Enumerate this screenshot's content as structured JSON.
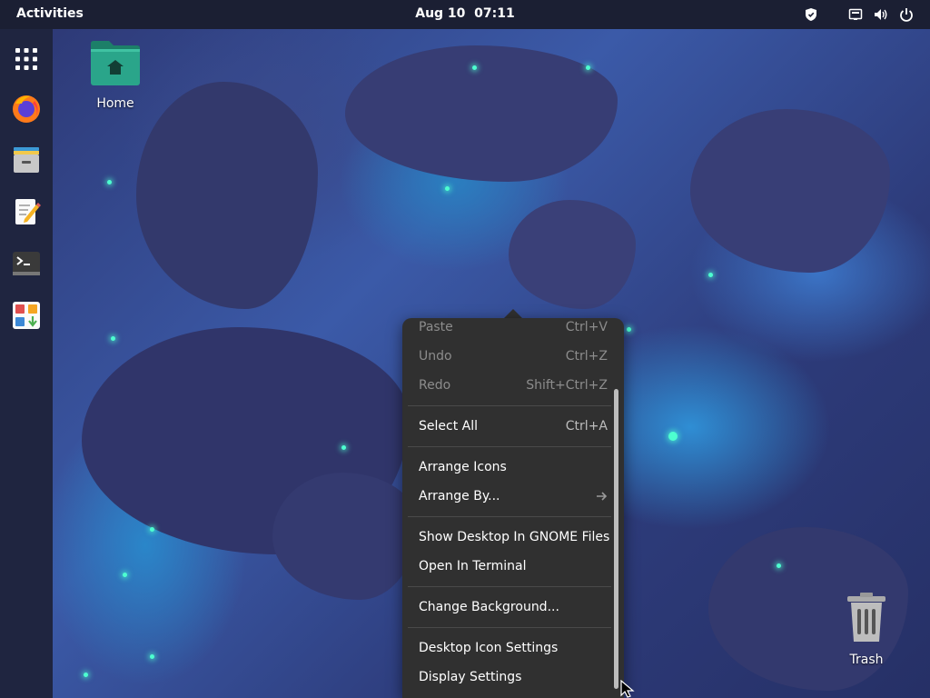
{
  "topbar": {
    "activities": "Activities",
    "date": "Aug 10",
    "time": "07:11",
    "indicators": [
      "shield-icon",
      "network-icon",
      "volume-icon",
      "power-icon"
    ]
  },
  "dock": {
    "items": [
      {
        "name": "app-grid",
        "icon": "grid-icon"
      },
      {
        "name": "firefox",
        "icon": "firefox-icon"
      },
      {
        "name": "files",
        "icon": "file-cabinet-icon"
      },
      {
        "name": "text-editor",
        "icon": "text-editor-icon"
      },
      {
        "name": "terminal",
        "icon": "terminal-icon"
      },
      {
        "name": "software",
        "icon": "software-icon"
      }
    ]
  },
  "desktop": {
    "home_label": "Home",
    "trash_label": "Trash"
  },
  "context_menu": {
    "paste": {
      "label": "Paste",
      "shortcut": "Ctrl+V"
    },
    "undo": {
      "label": "Undo",
      "shortcut": "Ctrl+Z"
    },
    "redo": {
      "label": "Redo",
      "shortcut": "Shift+Ctrl+Z"
    },
    "select_all": {
      "label": "Select All",
      "shortcut": "Ctrl+A"
    },
    "arrange_icons": {
      "label": "Arrange Icons"
    },
    "arrange_by": {
      "label": "Arrange By..."
    },
    "show_in_files": {
      "label": "Show Desktop In GNOME Files"
    },
    "open_terminal": {
      "label": "Open In Terminal"
    },
    "change_bg": {
      "label": "Change Background..."
    },
    "icon_settings": {
      "label": "Desktop Icon Settings"
    },
    "display_settings": {
      "label": "Display Settings"
    }
  },
  "colors": {
    "topbar": "#1b1f33",
    "menu_bg": "#303030",
    "folder": "#2aa58a"
  }
}
